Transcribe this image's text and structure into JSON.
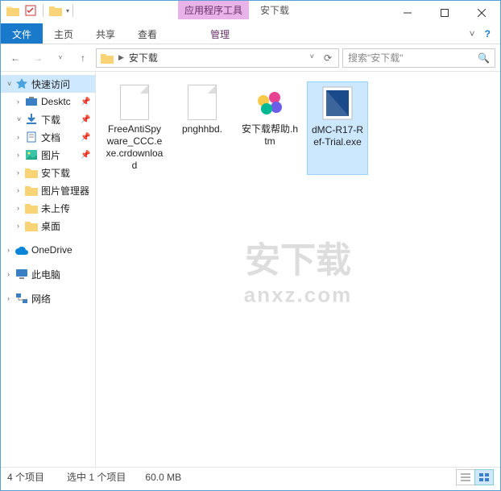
{
  "qat": {
    "dropdown": "▾"
  },
  "context_tab": {
    "highlight": "应用程序工具",
    "title": "安下载"
  },
  "ribbon": {
    "file": "文件",
    "tabs": [
      "主页",
      "共享",
      "查看"
    ],
    "ctx": "管理",
    "help": "?"
  },
  "nav": {
    "breadcrumb": [
      "安下载"
    ],
    "refresh": "⟳",
    "search_placeholder": "搜索\"安下载\""
  },
  "sidebar": {
    "quick": "快速访问",
    "items": [
      {
        "label": "Desktc",
        "pinned": true
      },
      {
        "label": "下载",
        "pinned": true
      },
      {
        "label": "文档",
        "pinned": true
      },
      {
        "label": "图片",
        "pinned": true
      },
      {
        "label": "安下载",
        "pinned": false
      },
      {
        "label": "图片管理器",
        "pinned": false
      },
      {
        "label": "未上传",
        "pinned": false
      },
      {
        "label": "桌面",
        "pinned": false
      }
    ],
    "onedrive": "OneDrive",
    "thispc": "此电脑",
    "network": "网络"
  },
  "files": [
    {
      "name": "FreeAntiSpyware_CCC.exe.crdownload",
      "type": "blank"
    },
    {
      "name": "pnghhbd.",
      "type": "blank"
    },
    {
      "name": "安下载帮助.htm",
      "type": "htm"
    },
    {
      "name": "dMC-R17-Ref-Trial.exe",
      "type": "exe",
      "selected": true
    }
  ],
  "watermark": {
    "main": "安下载",
    "sub": "anxz.com"
  },
  "status": {
    "count": "4 个项目",
    "selection": "选中 1 个项目",
    "size": "60.0 MB"
  }
}
